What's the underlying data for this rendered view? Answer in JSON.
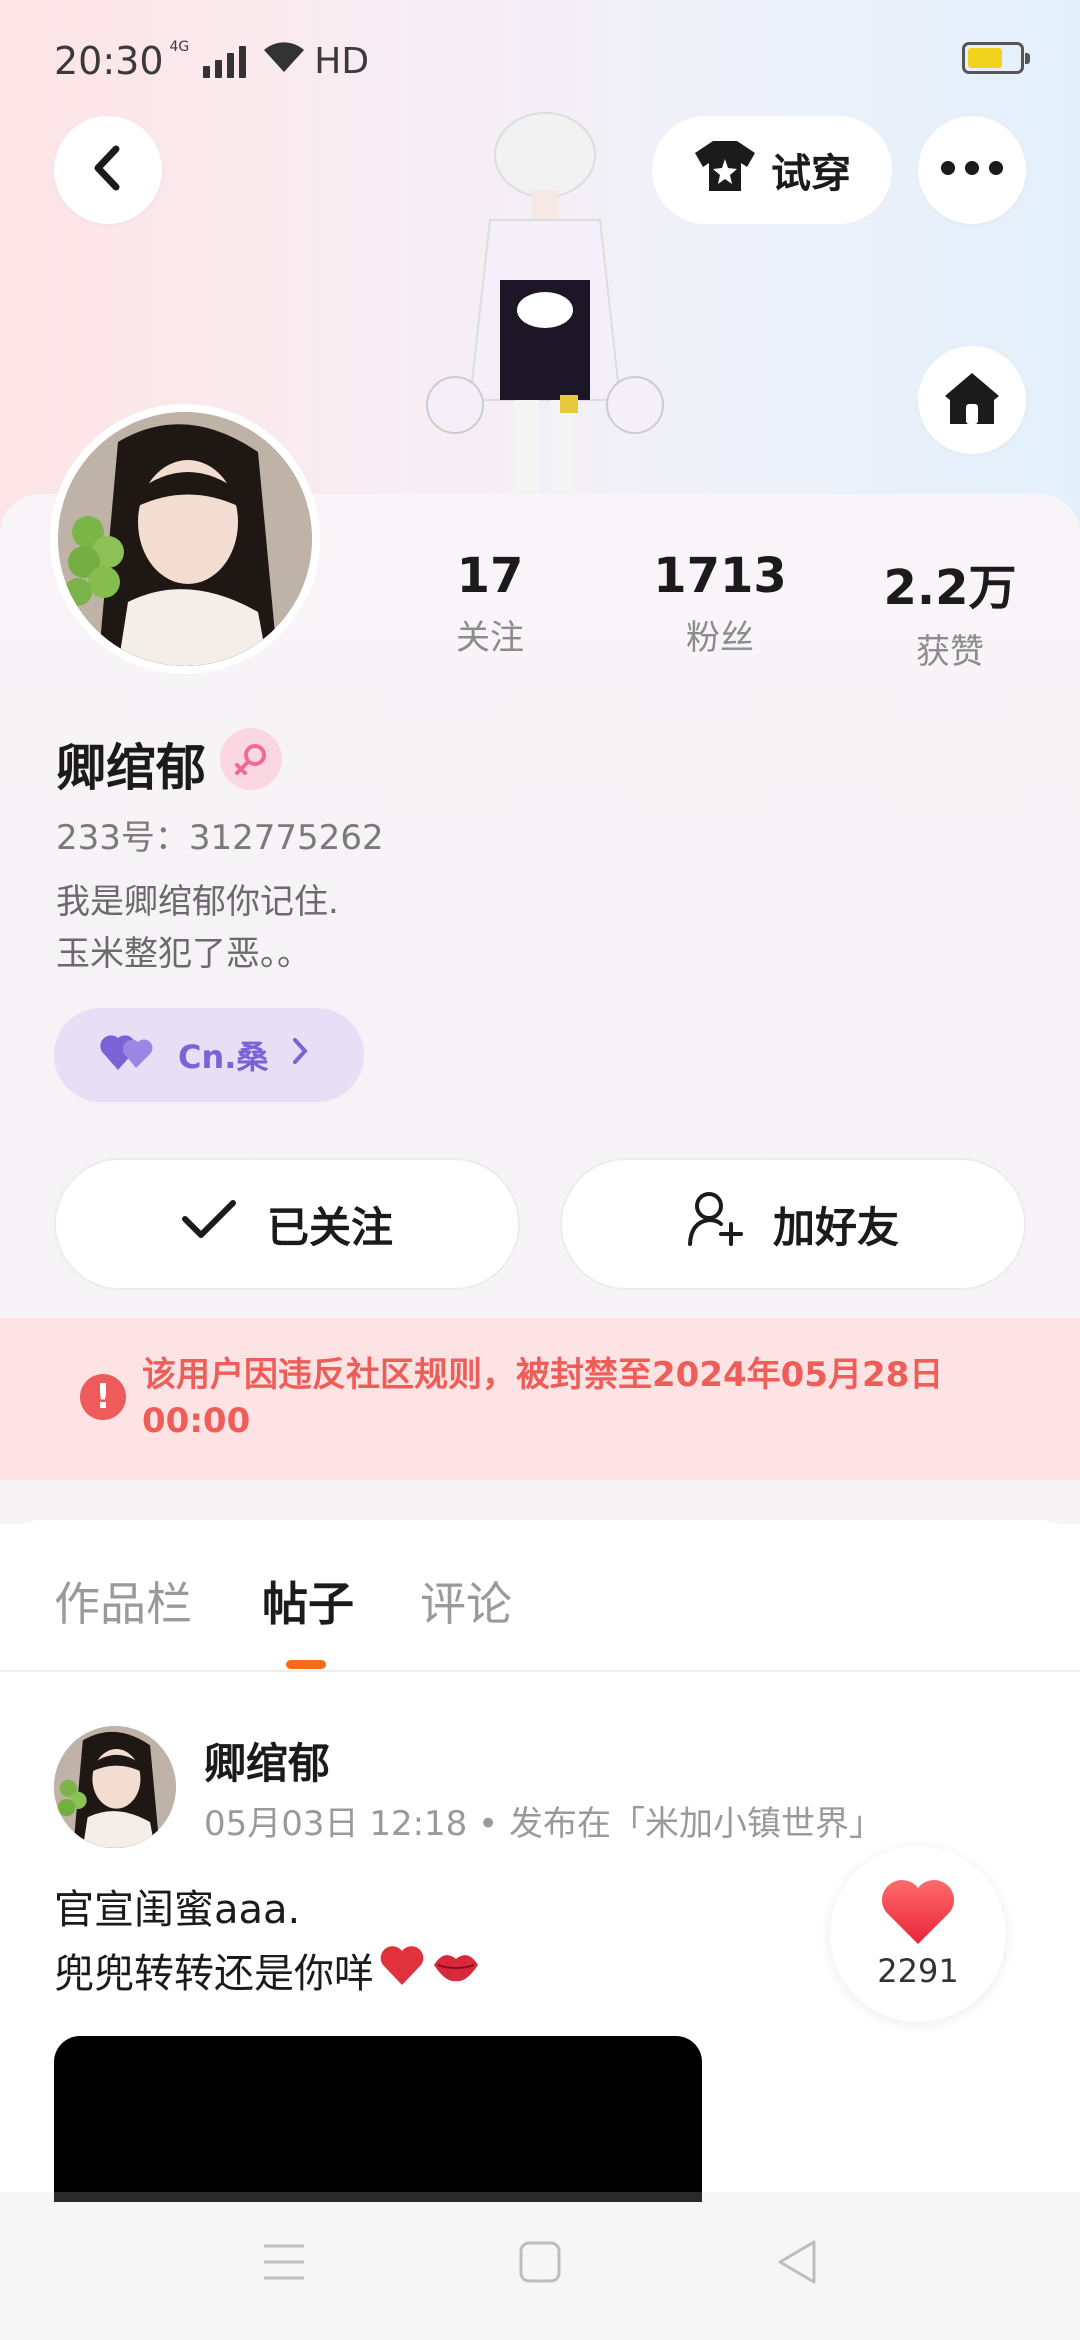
{
  "status_bar": {
    "time": "20:30",
    "network": "4G",
    "hd": "HD",
    "battery_level": 0.55,
    "battery_color": "#f2d31b"
  },
  "header": {
    "back_icon": "chevron-left-icon",
    "try_on_label": "试穿",
    "try_on_icon": "tshirt-icon",
    "more_icon": "more-dots-icon",
    "home_icon": "home-icon"
  },
  "profile": {
    "name": "卿绾郁",
    "gender_icon": "female-icon",
    "id_text": "233号：312775262",
    "bio_lines": [
      "我是卿绾郁你记住.",
      "玉米整犯了恶。。"
    ],
    "tag_label": "Cn.桑",
    "stats": [
      {
        "num": "17",
        "label": "关注"
      },
      {
        "num": "1713",
        "label": "粉丝"
      },
      {
        "num": "2.2万",
        "label": "获赞"
      }
    ]
  },
  "actions": {
    "followed_label": "已关注",
    "add_friend_label": "加好友"
  },
  "ban_notice": {
    "text": "该用户因违反社区规则，被封禁至2024年05月28日00:00",
    "color": "#ee5d57"
  },
  "tabs": [
    {
      "label": "作品栏",
      "active": false
    },
    {
      "label": "帖子",
      "active": true
    },
    {
      "label": "评论",
      "active": false
    }
  ],
  "accent_color": "#f66b1a",
  "post": {
    "author": "卿绾郁",
    "meta": "05月03日 12:18 • 发布在「米加小镇世界」",
    "lines": [
      "官宣闺蜜aaa.",
      "兜兜转转还是你咩"
    ],
    "like_count": "2291"
  },
  "nav": {
    "menu_icon": "menu-icon",
    "home_icon": "square-icon",
    "back_icon": "triangle-back-icon"
  }
}
